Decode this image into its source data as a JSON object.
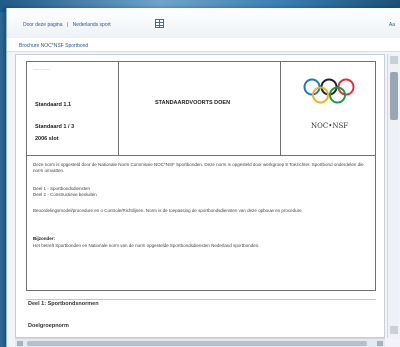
{
  "toolbar": {
    "link1": "Door deze pagina",
    "link2": "Nederlands sport",
    "right_text": "Aa"
  },
  "subtitle": "Brochure NOC*NSF Sportbond",
  "document": {
    "tiny_header": "------ ------",
    "left_line1": "Standaard 1.1",
    "left_line2": "Standaard 1 / 3",
    "left_line3": "2006 slot",
    "doc_title": "STANDAARDVOORTS DOEN",
    "logo_text": "NOC•NSF",
    "para1": "Deze norm is opgesteld door de Nationale Norm Commissie NOC*NSF Sportbonden. Deze norm is opgesteld door werkgroep 8 Toezichter. Sportbond onderdelen die norm omvatten.",
    "para2_l1": "Deel 1 - Sportbondsdiensten",
    "para2_l2": "Deel 2 - Constructieve besluiten",
    "para3": "Beoordelingsmodel/procedure en o Controle/Richtlijnen. Norm is de toepassing de sportbondsdiensten van deze opbouw en procedure.",
    "note_title": "Bijzonder:",
    "note_text": "Het betreft Sportbonden en Nationale norm van de norm opgestelde Sportbondsdiensten Nederland sportbonden.",
    "section1": "Deel 1: Sportbondsnormen",
    "section2": "Doelgroepnorm"
  },
  "colors": {
    "link": "#2a55a0",
    "olympic_blue": "#1f78c8",
    "olympic_yellow": "#f2b21c",
    "olympic_black": "#222222",
    "olympic_green": "#1a9a4a",
    "olympic_red": "#e0303a"
  }
}
